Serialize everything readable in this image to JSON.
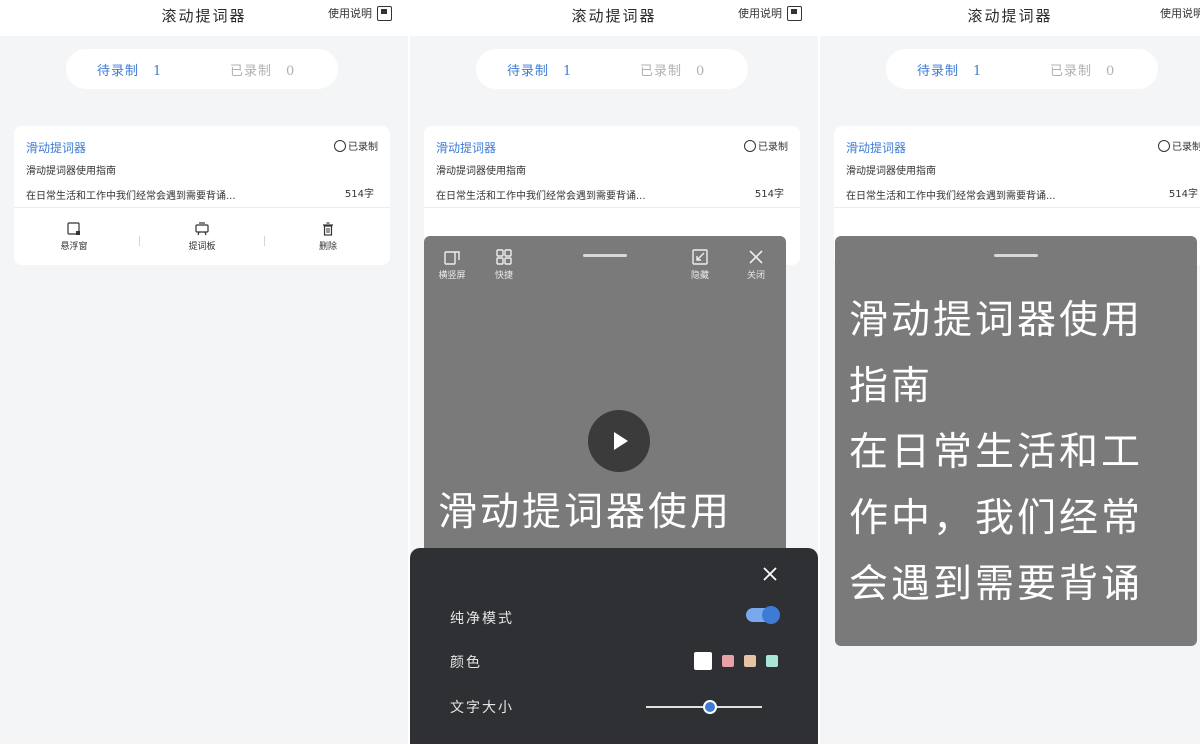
{
  "header": {
    "title": "滚动提词器",
    "help_label": "使用说明"
  },
  "tabs": [
    {
      "label": "待录制",
      "count": "1"
    },
    {
      "label": "已录制",
      "count": "0"
    }
  ],
  "card": {
    "title": "滑动提词器",
    "subtitle": "滑动提词器使用指南",
    "preview": "在日常生活和工作中我们经常会遇到需要背诵...",
    "word_count": "514字",
    "recorded_label": "已录制",
    "actions": [
      "悬浮窗",
      "提词板",
      "删除"
    ]
  },
  "overlay": {
    "tools": [
      "横竖屏",
      "快捷",
      "隐藏",
      "关闭"
    ],
    "big_text_p2": "滑动提词器使用",
    "big_text_p3": "滑动提词器使用\n指南\n在日常生活和工\n作中，我们经常\n会遇到需要背诵"
  },
  "settings": {
    "clean_mode_label": "纯净模式",
    "clean_mode_on": true,
    "color_label": "颜色",
    "colors": [
      "#ffffff",
      "#e8a3a8",
      "#e6c3a3",
      "#a9e6d8"
    ],
    "font_size_label": "文字大小",
    "font_size_level": 0.55
  }
}
